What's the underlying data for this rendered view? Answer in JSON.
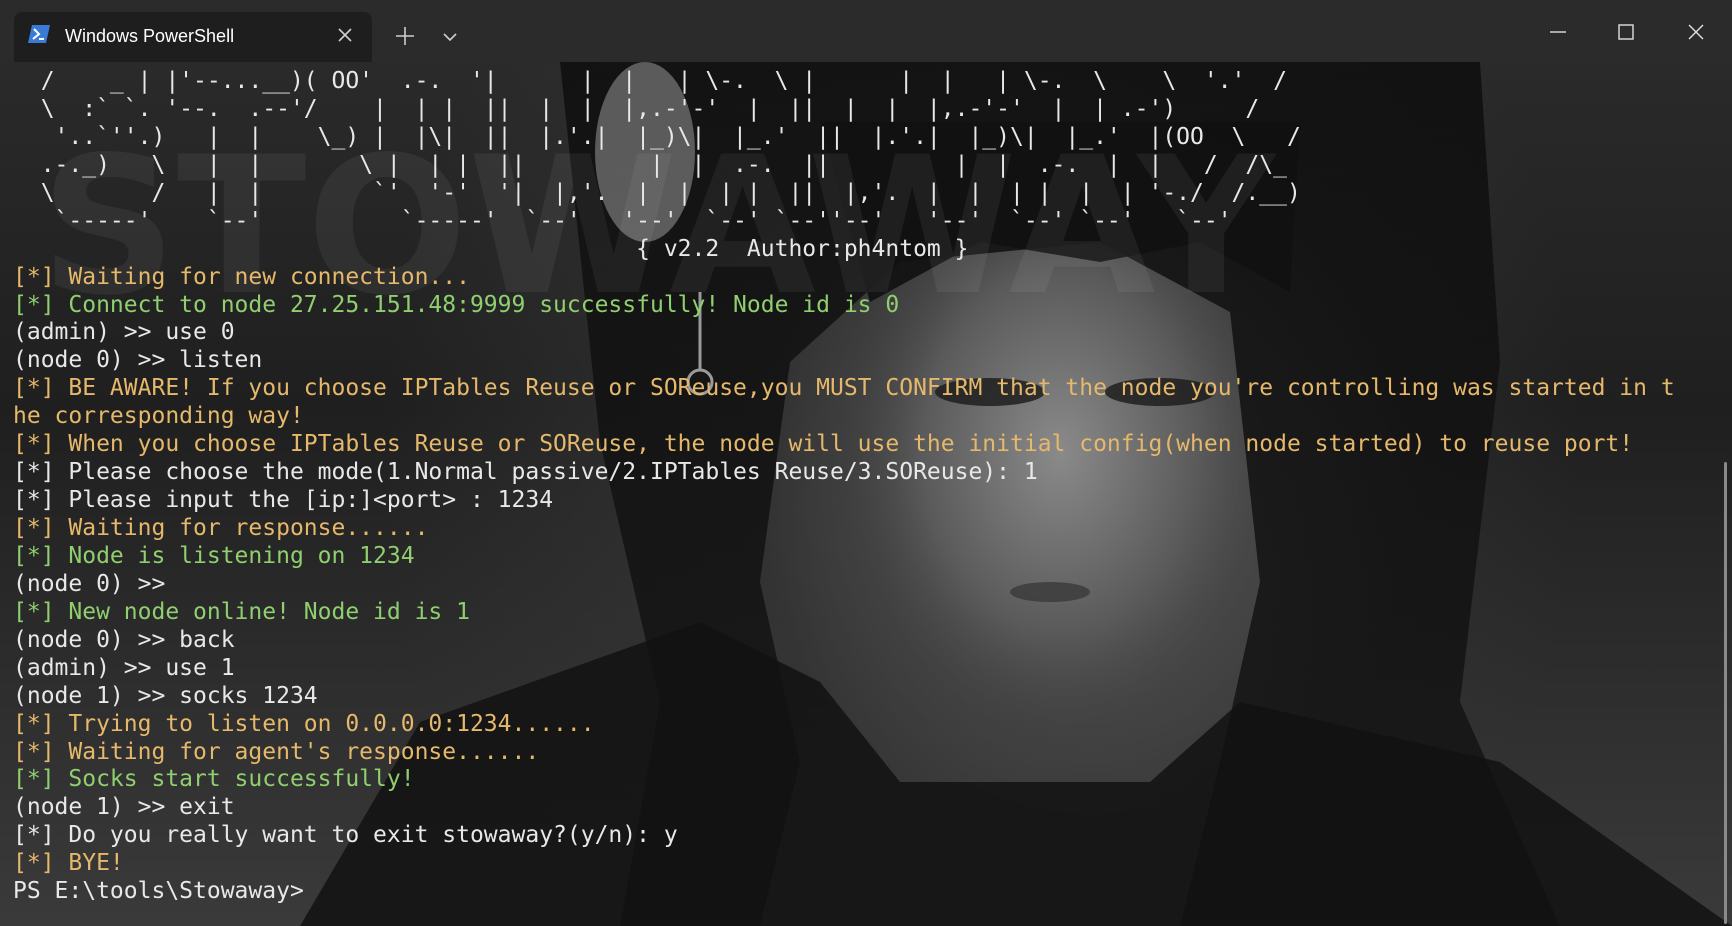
{
  "window": {
    "tab_title": "Windows PowerShell",
    "icons": {
      "tab": "powershell-icon",
      "tab_close": "close-icon",
      "new_tab": "plus-icon",
      "dropdown": "chevron-down-icon",
      "minimize": "minimize-icon",
      "maximize": "maximize-icon",
      "close": "close-icon"
    }
  },
  "colors": {
    "prompt_text": "#e8e8e8",
    "info_yellow": "#e5b86b",
    "success_green": "#8fcf6f",
    "titlebar": "#2b2b2b",
    "accent_blue": "#3a7bd5"
  },
  "terminal": {
    "lines": [
      {
        "text": "  /    _ | |'--...__)( OO'  .-.  '|      |  |   | \\-.  \\ |      |  |   | \\-.  \\    \\  '.'  /",
        "color": "white"
      },
      {
        "text": "  \\  :` `. '--.  .--'/    |  | |  ||  |  |  |,.-'-'  |  ||  |  |  |,.-'-'  |  | .-')     /",
        "color": "white"
      },
      {
        "text": "   '..`''.)   |  |    \\_) |  |\\|  ||  |.'.|  |_)\\|  |_.'  ||  |.'.|  |_)\\|  |_.'  |(OO  \\   /",
        "color": "white"
      },
      {
        "text": "  .-._)   \\   |  |       \\ |  | |  ||         |  |  .-.  ||         |  |  .-.  |  |   /  /\\_",
        "color": "white"
      },
      {
        "text": "  \\       /   |  |        `'  '-'  '|  |,'.  |  |  | |  ||  |,'.  |  |  | |  |  | '-./  /.__)",
        "color": "white"
      },
      {
        "text": "   `-----'    `--'          `-----'  `--'   '--'  `--' `--''--'   '--'  `--' `--'   `--'",
        "color": "white"
      },
      {
        "text": "                                             { v2.2  Author:ph4ntom }",
        "color": "white"
      },
      {
        "text": "[*] Waiting for new connection...",
        "color": "yellow"
      },
      {
        "text": "[*] Connect to node 27.25.151.48:9999 successfully! Node id is 0",
        "color": "green"
      },
      {
        "text": "(admin) >> use 0",
        "color": "white"
      },
      {
        "text": "(node 0) >> listen",
        "color": "white"
      },
      {
        "text": "[*] BE AWARE! If you choose IPTables Reuse or SOReuse,you MUST CONFIRM that the node you're controlling was started in t",
        "color": "yellow"
      },
      {
        "text": "he corresponding way!",
        "color": "yellow"
      },
      {
        "text": "[*] When you choose IPTables Reuse or SOReuse, the node will use the initial config(when node started) to reuse port!",
        "color": "yellow"
      },
      {
        "text": "[*] Please choose the mode(1.Normal passive/2.IPTables Reuse/3.SOReuse): 1",
        "color": "white"
      },
      {
        "text": "[*] Please input the [ip:]<port> : 1234",
        "color": "white"
      },
      {
        "text": "[*] Waiting for response......",
        "color": "yellow"
      },
      {
        "text": "[*] Node is listening on 1234",
        "color": "green"
      },
      {
        "text": "(node 0) >>",
        "color": "white"
      },
      {
        "text": "[*] New node online! Node id is 1",
        "color": "green"
      },
      {
        "text": "(node 0) >> back",
        "color": "white"
      },
      {
        "text": "(admin) >> use 1",
        "color": "white"
      },
      {
        "text": "(node 1) >> socks 1234",
        "color": "white"
      },
      {
        "text": "[*] Trying to listen on 0.0.0.0:1234......",
        "color": "yellow"
      },
      {
        "text": "[*] Waiting for agent's response......",
        "color": "yellow"
      },
      {
        "text": "[*] Socks start successfully!",
        "color": "green"
      },
      {
        "text": "(node 1) >> exit",
        "color": "white"
      },
      {
        "text": "[*] Do you really want to exit stowaway?(y/n): y",
        "color": "white"
      },
      {
        "text": "[*] BYE!",
        "color": "yellow"
      },
      {
        "text": "PS E:\\tools\\Stowaway>",
        "color": "white"
      }
    ]
  }
}
